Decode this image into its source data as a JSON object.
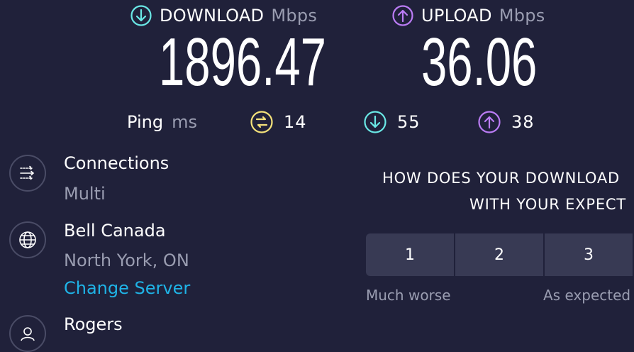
{
  "download": {
    "label": "DOWNLOAD",
    "unit": "Mbps",
    "value": "1896.47",
    "icon": "download-arrow-icon",
    "color": "#6ae8e6"
  },
  "upload": {
    "label": "UPLOAD",
    "unit": "Mbps",
    "value": "36.06",
    "icon": "upload-arrow-icon",
    "color": "#bb7cf5"
  },
  "ping": {
    "label": "Ping",
    "unit": "ms",
    "idle": "14",
    "download": "55",
    "upload": "38",
    "idle_color": "#f5e27a"
  },
  "connections": {
    "title": "Connections",
    "value": "Multi",
    "icon": "connections-icon"
  },
  "server": {
    "isp": "Bell Canada",
    "location": "North York, ON",
    "change_label": "Change Server",
    "icon": "globe-icon"
  },
  "provider": {
    "name": "Rogers",
    "icon": "user-icon"
  },
  "survey": {
    "question_line1": "HOW DOES YOUR DOWNLOAD",
    "question_line2": "WITH YOUR EXPECT",
    "ratings": [
      "1",
      "2",
      "3"
    ],
    "low_label": "Much worse",
    "mid_label": "As expected"
  }
}
